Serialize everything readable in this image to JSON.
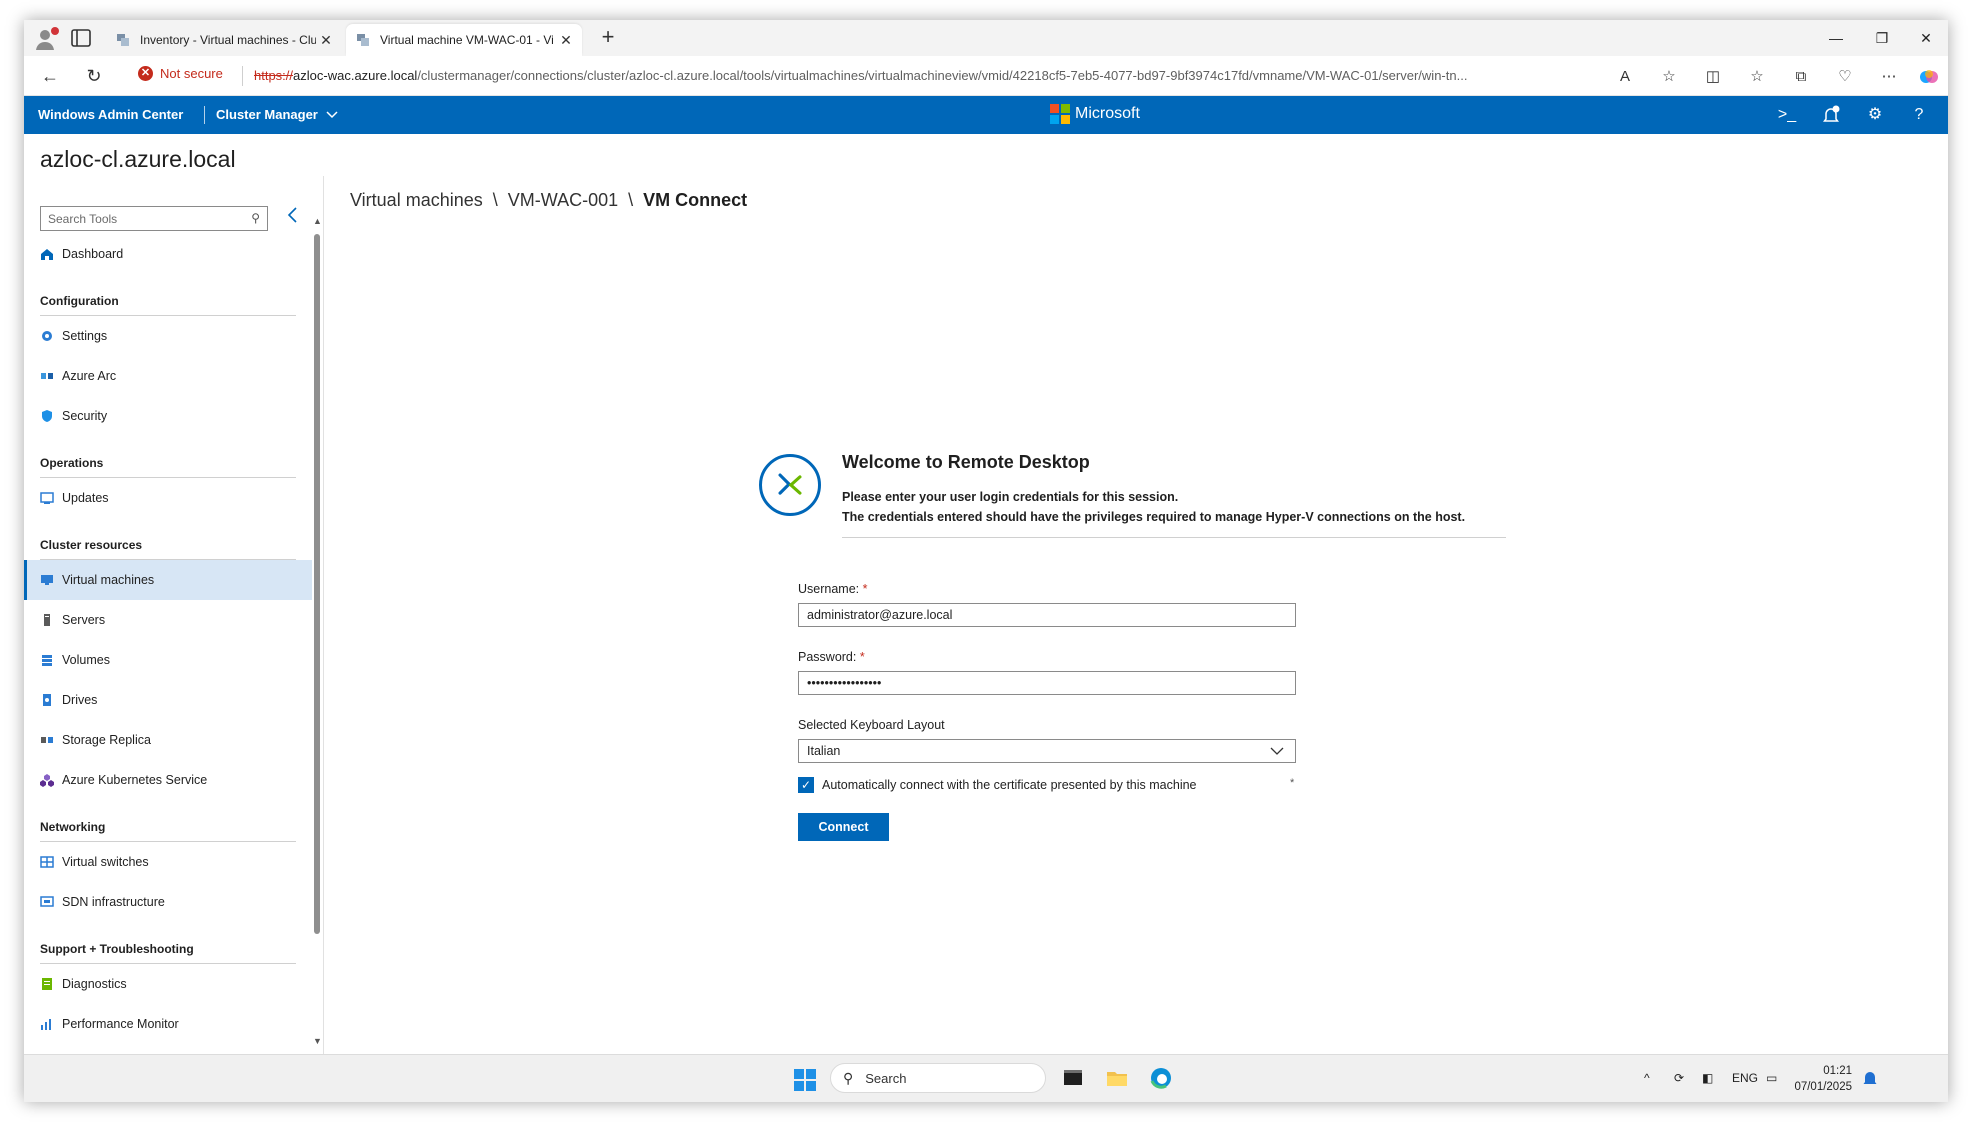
{
  "browser": {
    "tabs": [
      {
        "title": "Inventory - Virtual machines - Clu"
      },
      {
        "title": "Virtual machine VM-WAC-01 - Vi"
      }
    ],
    "address": {
      "security": "Not secure",
      "scheme": "https://",
      "host": "azloc-wac.azure.local",
      "path": "/clustermanager/connections/cluster/azloc-cl.azure.local/tools/virtualmachines/virtualmachineview/vmid/42218cf5-7eb5-4077-bd97-9bf3974c17fd/vmname/VM-WAC-01/server/win-tn..."
    }
  },
  "header": {
    "brand": "Windows Admin Center",
    "context": "Cluster Manager",
    "center_brand": "Microsoft"
  },
  "cluster": {
    "name": "azloc-cl.azure.local"
  },
  "sidebar": {
    "search_placeholder": "Search Tools",
    "dashboard": "Dashboard",
    "groups": {
      "configuration": "Configuration",
      "operations": "Operations",
      "cluster_resources": "Cluster resources",
      "networking": "Networking",
      "support": "Support + Troubleshooting"
    },
    "items": {
      "settings": "Settings",
      "azure_arc": "Azure Arc",
      "security": "Security",
      "updates": "Updates",
      "virtual_machines": "Virtual machines",
      "servers": "Servers",
      "volumes": "Volumes",
      "drives": "Drives",
      "storage_replica": "Storage Replica",
      "aks": "Azure Kubernetes Service",
      "virtual_switches": "Virtual switches",
      "sdn": "SDN infrastructure",
      "diagnostics": "Diagnostics",
      "perfmon": "Performance Monitor"
    }
  },
  "breadcrumb": {
    "level1": "Virtual machines",
    "level2": "VM-WAC-001",
    "current": "VM Connect",
    "separator": "\\"
  },
  "rdp": {
    "title": "Welcome to Remote Desktop",
    "desc_line1": "Please enter your user login credentials for this session.",
    "desc_line2": "The credentials entered should have the privileges required to manage Hyper-V connections on the host.",
    "username_label": "Username:",
    "username_value": "administrator@azure.local",
    "password_label": "Password:",
    "password_value": "•••••••••••••••••",
    "required_mark": "*",
    "keyboard_label": "Selected Keyboard Layout",
    "keyboard_value": "Italian",
    "auto_connect_label": "Automatically connect with the certificate presented by this machine",
    "auto_connect_checked": true,
    "connect_label": "Connect"
  },
  "taskbar": {
    "search_label": "Search",
    "language": "ENG",
    "time": "01:21",
    "date": "07/01/2025"
  },
  "colors": {
    "accent": "#0067b8",
    "selected_nav_bg": "#d7e6f5",
    "error": "#c42b1c"
  }
}
